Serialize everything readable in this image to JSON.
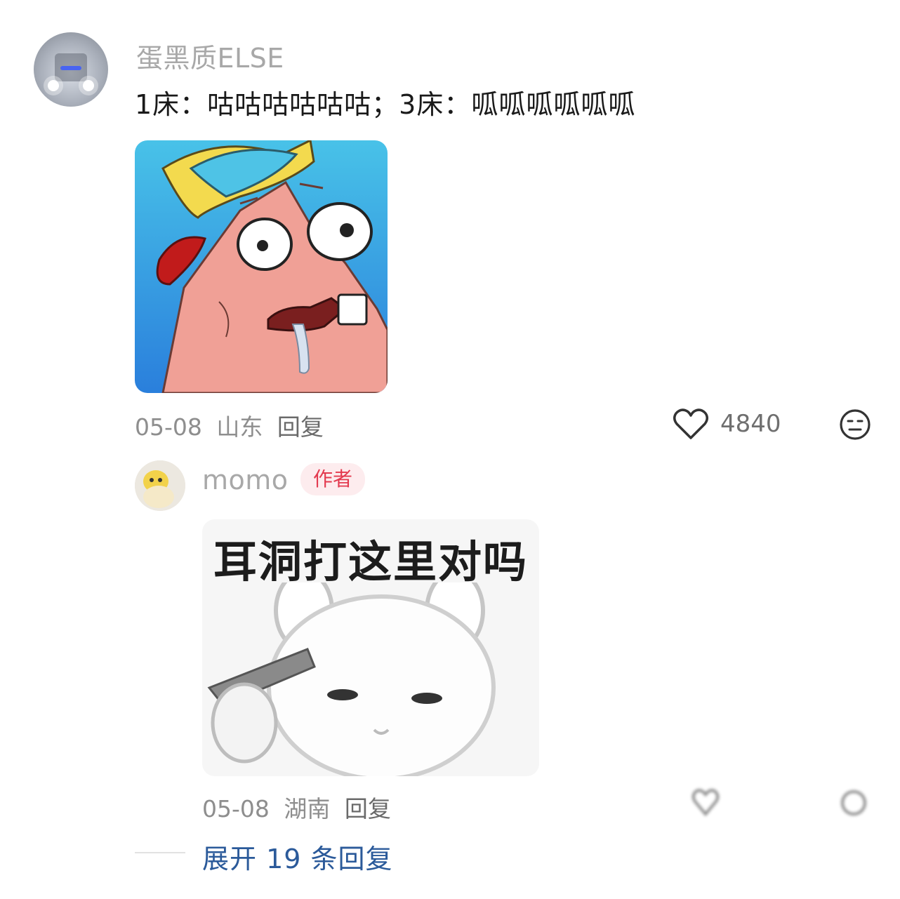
{
  "comment": {
    "username": "蛋黑质ELSE",
    "text": "1床：咕咕咕咕咕咕；3床：呱呱呱呱呱呱",
    "avatar_icon": "car-headlights-avatar",
    "image_icon": "patrick-star-meme",
    "date": "05-08",
    "location": "山东",
    "reply_label": "回复",
    "like_count": "4840",
    "like_icon": "heart-outline-icon",
    "dislike_icon": "neutral-face-icon"
  },
  "reply": {
    "username": "momo",
    "badge": "作者",
    "avatar_icon": "yellow-toy-avatar",
    "meme_caption": "耳洞打这里对吗",
    "image_icon": "bunny-with-gun-meme",
    "date": "05-08",
    "location": "湖南",
    "reply_label": "回复"
  },
  "expand": {
    "label": "展开 19 条回复"
  },
  "colors": {
    "accent_link": "#2b5a9a",
    "badge_red": "#e33a4f",
    "badge_bg": "#fdecee",
    "meme_blue": "#2f8fe0"
  }
}
